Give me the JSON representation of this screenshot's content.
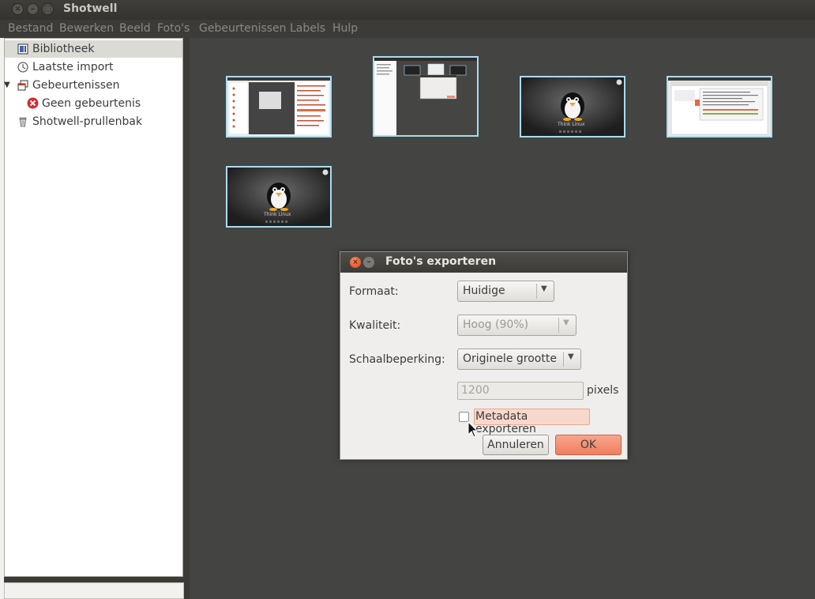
{
  "window": {
    "title": "Shotwell"
  },
  "menu": [
    "Bestand",
    "Bewerken",
    "Beeld",
    "Foto's",
    "Gebeurtenissen",
    "Labels",
    "Hulp"
  ],
  "sidebar": {
    "items": [
      {
        "label": "Bibliotheek",
        "icon": "library-icon",
        "selected": true
      },
      {
        "label": "Laatste import",
        "icon": "clock-icon"
      },
      {
        "label": "Gebeurtenissen",
        "icon": "events-icon",
        "expanded": true
      },
      {
        "label": "Geen gebeurtenis",
        "icon": "error-icon"
      },
      {
        "label": "Shotwell-prullenbak",
        "icon": "trash-icon"
      }
    ]
  },
  "photos": [
    {
      "kind": "screenshot-app"
    },
    {
      "kind": "screenshot-dialog"
    },
    {
      "kind": "tux-wallpaper",
      "caption": "Think Linux"
    },
    {
      "kind": "screenshot-browser"
    },
    {
      "kind": "tux-wallpaper",
      "caption": "Think Linux"
    }
  ],
  "dialog": {
    "title": "Foto's exporteren",
    "format_label": "Formaat:",
    "format_value": "Huidige",
    "quality_label": "Kwaliteit:",
    "quality_value": "Hoog (90%)",
    "scale_label": "Schaalbeperking:",
    "scale_value": "Originele grootte",
    "pixels_value": "1200",
    "pixels_unit": "pixels",
    "metadata_label": "Metadata exporteren",
    "metadata_checked": false,
    "cancel_label": "Annuleren",
    "ok_label": "OK"
  },
  "colors": {
    "accent": "#f28b6f",
    "selection_border": "#a9dcef",
    "panel": "#444442"
  }
}
